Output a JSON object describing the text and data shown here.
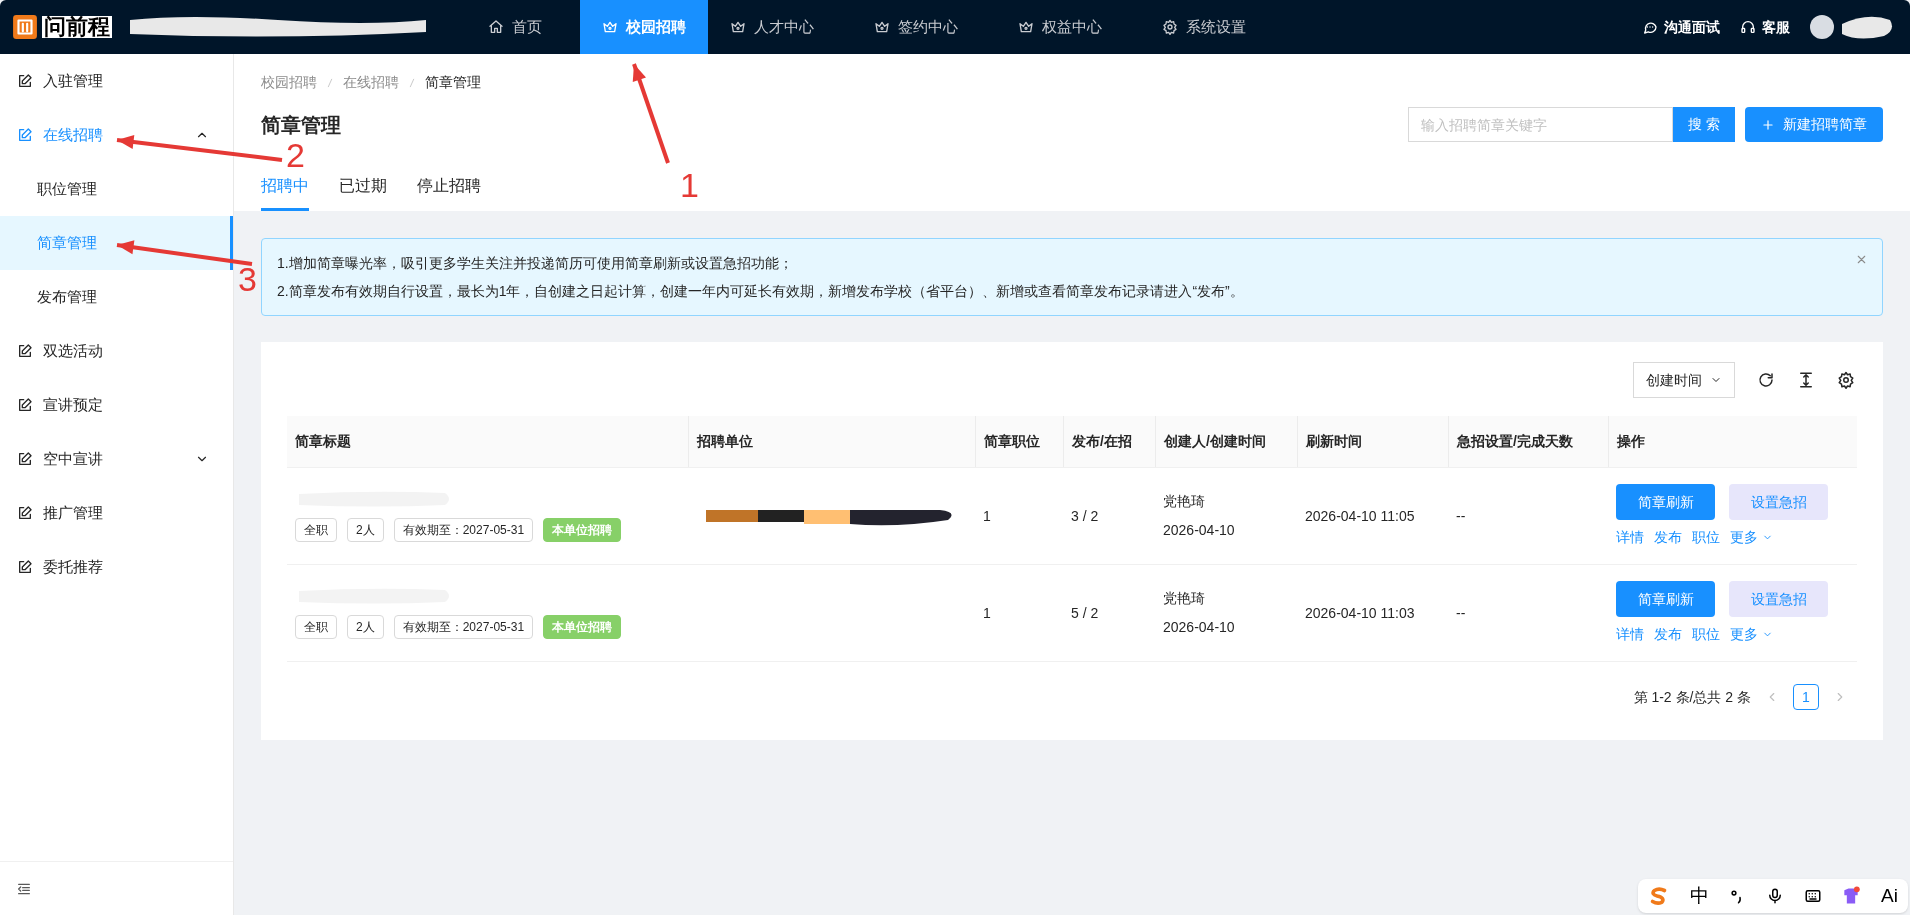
{
  "topbar": {
    "logo_text": "问前程",
    "nav": [
      {
        "label": "首页",
        "selected": false
      },
      {
        "label": "校园招聘",
        "selected": true
      },
      {
        "label": "人才中心",
        "selected": false
      },
      {
        "label": "签约中心",
        "selected": false
      },
      {
        "label": "权益中心",
        "selected": false
      },
      {
        "label": "系统设置",
        "selected": false
      }
    ],
    "actions": [
      "沟通面试",
      "客服"
    ]
  },
  "sidebar": {
    "items": [
      {
        "label": "入驻管理",
        "kind": "link",
        "selected": false
      },
      {
        "label": "在线招聘",
        "kind": "group",
        "selected": true,
        "expanded": true,
        "children": [
          {
            "label": "职位管理",
            "selected": false
          },
          {
            "label": "简章管理",
            "selected": true
          },
          {
            "label": "发布管理",
            "selected": false
          }
        ]
      },
      {
        "label": "双选活动",
        "kind": "link",
        "selected": false
      },
      {
        "label": "宣讲预定",
        "kind": "link",
        "selected": false
      },
      {
        "label": "空中宣讲",
        "kind": "group",
        "selected": false,
        "expanded": false
      },
      {
        "label": "推广管理",
        "kind": "link",
        "selected": false
      },
      {
        "label": "委托推荐",
        "kind": "link",
        "selected": false
      }
    ]
  },
  "breadcrumb": [
    "校园招聘",
    "在线招聘",
    "简章管理"
  ],
  "page_title": "简章管理",
  "search": {
    "placeholder": "输入招聘简章关键字",
    "button": "搜 索"
  },
  "new_button": "新建招聘简章",
  "tabs": [
    {
      "label": "招聘中",
      "selected": true
    },
    {
      "label": "已过期",
      "selected": false
    },
    {
      "label": "停止招聘",
      "selected": false
    }
  ],
  "notice": [
    "1.增加简章曝光率，吸引更多学生关注并投递简历可使用简章刷新或设置急招功能；",
    "2.简章发布有效期自行设置，最长为1年，自创建之日起计算，创建一年内可延长有效期，新增发布学校（省平台）、新增或查看简章发布记录请进入“发布”。"
  ],
  "sort": "创建时间",
  "table": {
    "columns": [
      "简章标题",
      "招聘单位",
      "简章职位",
      "发布/在招",
      "创建人/创建时间",
      "刷新时间",
      "急招设置/完成天数",
      "操作"
    ],
    "rows": [
      {
        "tags": [
          {
            "text": "全职",
            "kind": "plain"
          },
          {
            "text": "2人",
            "kind": "plain"
          },
          {
            "text": "有效期至：2027-05-31",
            "kind": "plain"
          },
          {
            "text": "本单位招聘",
            "kind": "green"
          }
        ],
        "unit_redacted": true,
        "positions": "1",
        "published": "3 / 2",
        "creator": "党艳琦",
        "created": "2026-04-10",
        "refreshed": "2026-04-10 11:05",
        "urgent": "--",
        "buttons": [
          "简章刷新",
          "设置急招"
        ],
        "links": [
          "详情",
          "发布",
          "职位",
          "更多"
        ]
      },
      {
        "tags": [
          {
            "text": "全职",
            "kind": "plain"
          },
          {
            "text": "2人",
            "kind": "plain"
          },
          {
            "text": "有效期至：2027-05-31",
            "kind": "plain"
          },
          {
            "text": "本单位招聘",
            "kind": "green"
          }
        ],
        "unit_redacted": false,
        "positions": "1",
        "published": "5 / 2",
        "creator": "党艳琦",
        "created": "2026-04-10",
        "refreshed": "2026-04-10 11:03",
        "urgent": "--",
        "buttons": [
          "简章刷新",
          "设置急招"
        ],
        "links": [
          "详情",
          "发布",
          "职位",
          "更多"
        ]
      }
    ]
  },
  "pagination": {
    "summary": "第 1-2 条/总共 2 条",
    "pages": [
      {
        "label": "1",
        "selected": true
      }
    ]
  },
  "annotations": [
    "1",
    "2",
    "3"
  ],
  "ime_bar": {
    "items": [
      "中",
      "Ai"
    ]
  }
}
